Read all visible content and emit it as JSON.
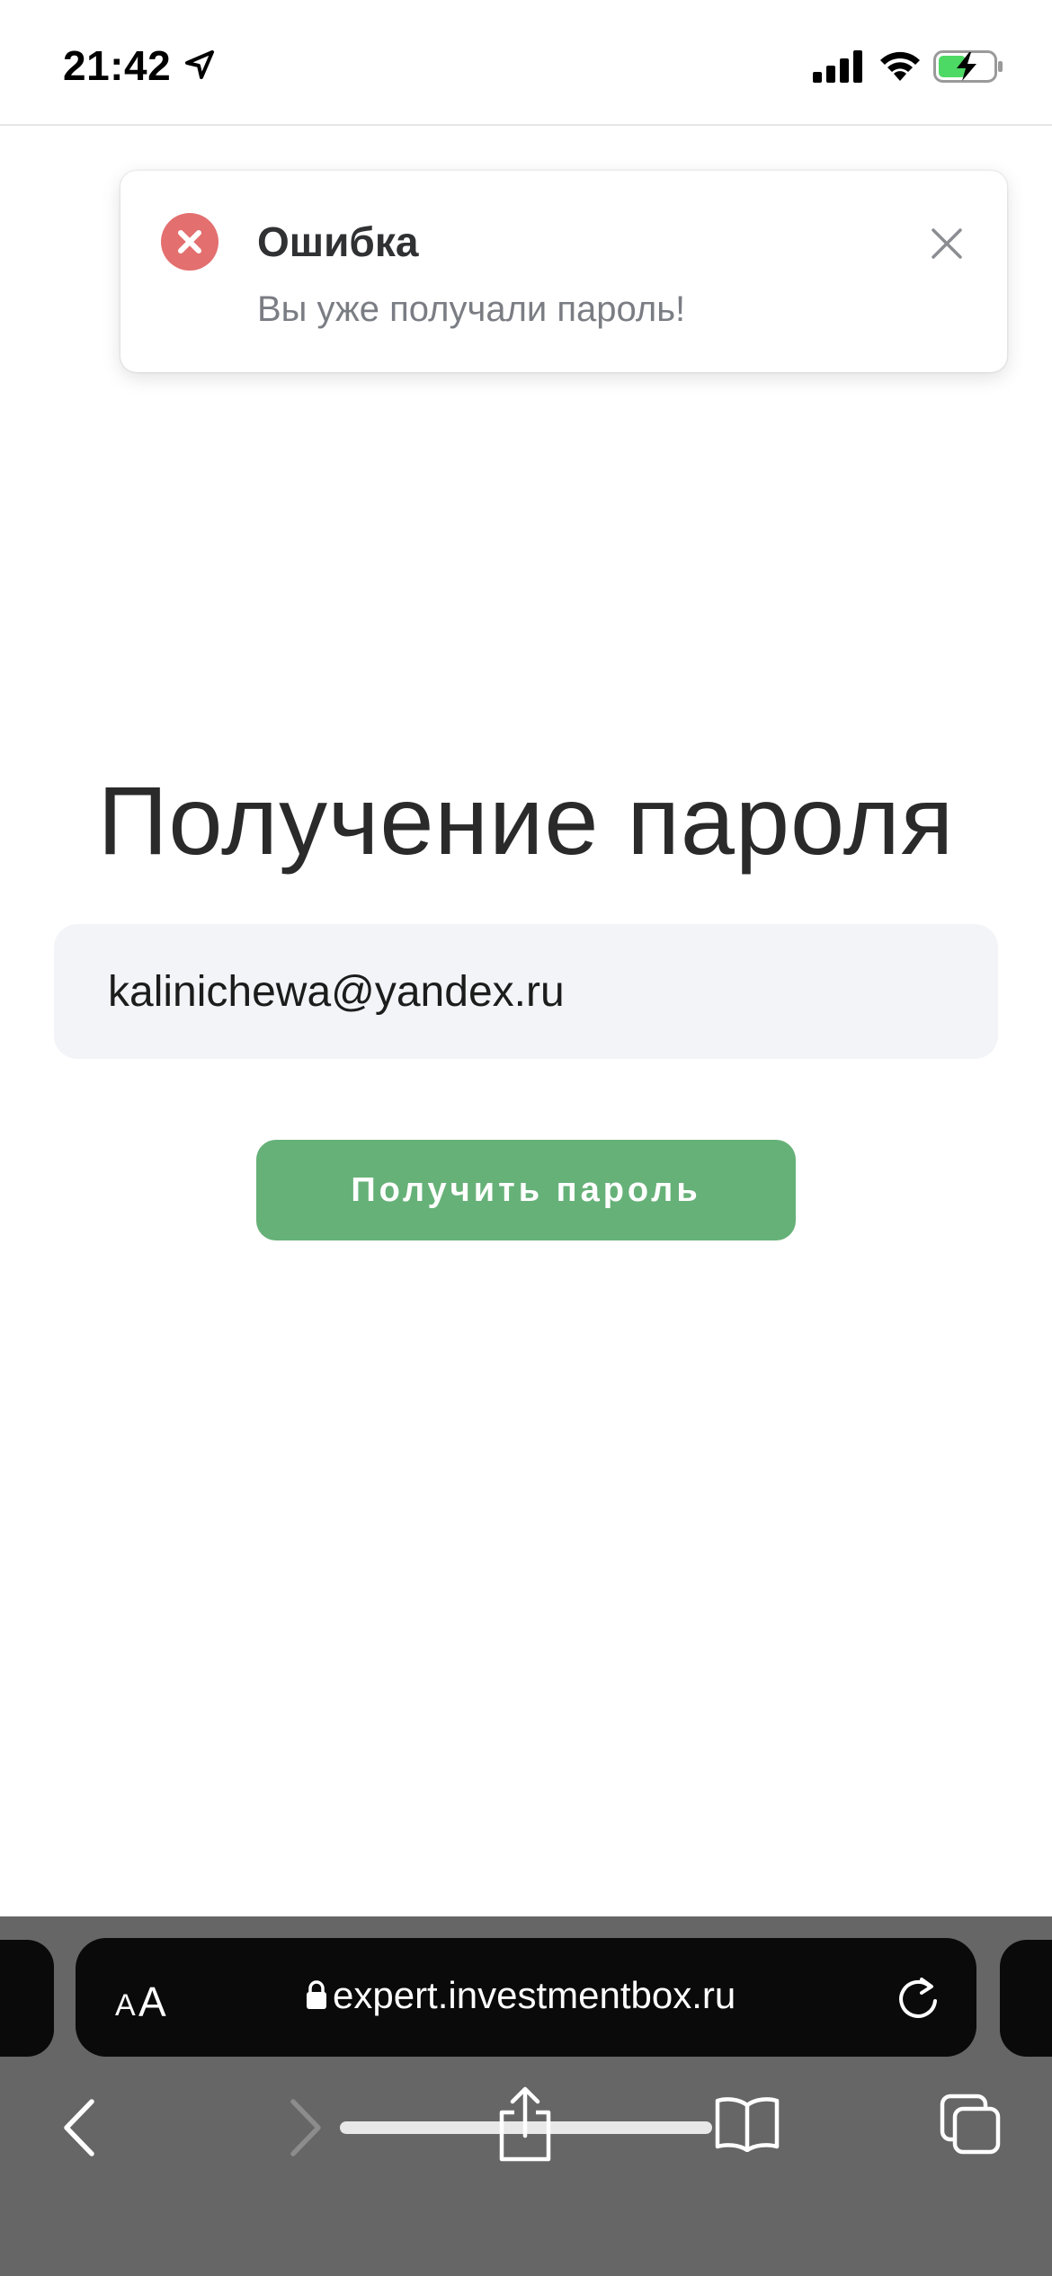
{
  "status_bar": {
    "time": "21:42",
    "icons": [
      "location-arrow-icon",
      "cellular-signal-icon",
      "wifi-icon",
      "battery-charging-icon"
    ]
  },
  "toast": {
    "type": "error",
    "title": "Ошибка",
    "message": "Вы уже получали пароль!",
    "icon": "error-circle-icon",
    "close_icon": "close-icon",
    "accent_color": "#e36f6f"
  },
  "form": {
    "title": "Получение пароля",
    "email_value": "kalinichewa@yandex.ru",
    "submit_label": "Получить пароль",
    "submit_color": "#66b178"
  },
  "browser": {
    "text_size_label_small": "A",
    "text_size_label_big": "A",
    "url": "expert.investmentbox.ru",
    "icons": [
      "lock-icon",
      "reload-icon",
      "back-icon",
      "forward-icon",
      "share-icon",
      "bookmarks-icon",
      "tabs-icon"
    ]
  }
}
